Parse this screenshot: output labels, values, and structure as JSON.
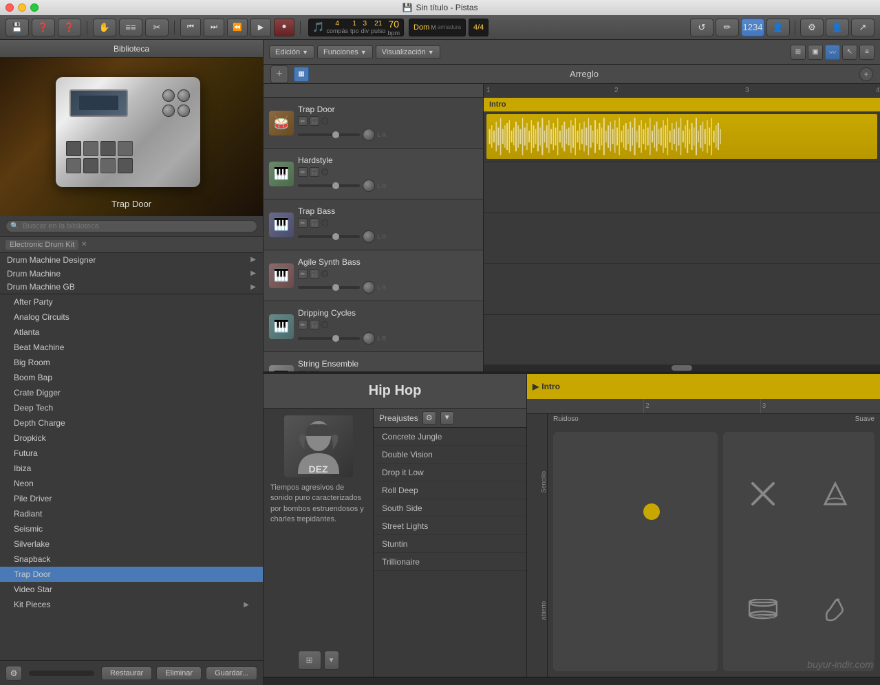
{
  "titlebar": {
    "title": "Sin título - Pistas",
    "save_icon": "💾"
  },
  "toolbar": {
    "buttons": [
      "💾",
      "❓",
      "❓",
      "✋",
      "≡≡",
      "✂"
    ],
    "transport": {
      "rewind": "⏮",
      "fast_forward": "⏭",
      "back": "⏪",
      "play": "▶",
      "record": "⏺"
    },
    "lcd": {
      "bars": "4",
      "tpo": "1",
      "div": "3",
      "pulso": "21",
      "bpm": "70",
      "key": "Dom",
      "mode": "M",
      "time_sig": "4/4",
      "bars_label": "compás",
      "tpo_label": "tpo",
      "div_label": "div",
      "pulso_label": "pulso",
      "bpm_label": "bpm",
      "armadura_label": "armadura",
      "compas_label": "compás"
    },
    "right_buttons": [
      "↺",
      "✏",
      "1234",
      "👤"
    ]
  },
  "library": {
    "title": "Biblioteca",
    "instrument_name": "Trap Door",
    "search_placeholder": "Buscar en la biblioteca",
    "breadcrumb": "Electronic Drum Kit",
    "categories": [
      {
        "label": "Drum Machine Designer",
        "has_arrow": true
      },
      {
        "label": "Drum Machine",
        "has_arrow": true
      },
      {
        "label": "Drum Machine GB",
        "has_arrow": true
      }
    ],
    "items": [
      "After Party",
      "Analog Circuits",
      "Atlanta",
      "Beat Machine",
      "Big Room",
      "Boom Bap",
      "Crate Digger",
      "Deep Tech",
      "Depth Charge",
      "Dropkick",
      "Futura",
      "Ibiza",
      "Neon",
      "Pile Driver",
      "Radiant",
      "Seismic",
      "Silverlake",
      "Snapback",
      "Trap Door",
      "Video Star",
      "Kit Pieces"
    ],
    "selected_item": "Trap Door",
    "footer": {
      "settings_icon": "⚙",
      "restore_label": "Restaurar",
      "delete_label": "Eliminar",
      "save_label": "Guardar..."
    }
  },
  "arrangement": {
    "header": {
      "menus": [
        "Edición",
        "Funciones",
        "Visualización"
      ],
      "add_label": "+",
      "section_label": "Arreglo",
      "section_add": "+"
    },
    "intro_region": {
      "label": "Intro",
      "marker": "Intro"
    },
    "ruler": {
      "marks": [
        "1",
        "2",
        "3",
        "4"
      ]
    },
    "tracks": [
      {
        "name": "Trap Door",
        "icon_class": "track-icon-trap",
        "icon": "🥁"
      },
      {
        "name": "Hardstyle",
        "icon_class": "track-icon-hard",
        "icon": "🎹"
      },
      {
        "name": "Trap Bass",
        "icon_class": "track-icon-bass",
        "icon": "🎹"
      },
      {
        "name": "Agile Synth Bass",
        "icon_class": "track-icon-agile",
        "icon": "🎹"
      },
      {
        "name": "Dripping Cycles",
        "icon_class": "track-icon-drip",
        "icon": "🎹"
      },
      {
        "name": "String Ensemble",
        "icon_class": "track-icon-string",
        "icon": "🎹"
      }
    ]
  },
  "hiphop": {
    "title": "Hip Hop",
    "artist_name": "DEZ",
    "description": "Tiempos agresivos de sonido puro caracterizados por bombos estruendosos y charles trepidantes.",
    "presets": {
      "label": "Preajustes",
      "items": [
        "Concrete Jungle",
        "Double Vision",
        "Drop it Low",
        "Roll Deep",
        "South Side",
        "Street Lights",
        "Stuntin",
        "Trillionaire"
      ]
    }
  },
  "drum_machine": {
    "region_label": "Intro",
    "ruler_marks": [
      "2",
      "3"
    ],
    "section_labels": {
      "loud": "Ruidoso",
      "medium": "",
      "soft": "Suave"
    },
    "y_labels": {
      "sencillo": "Sencillo",
      "abierto": "abierto"
    },
    "watermark": "buyur-indir.com"
  },
  "bottom_scrollbar": {}
}
